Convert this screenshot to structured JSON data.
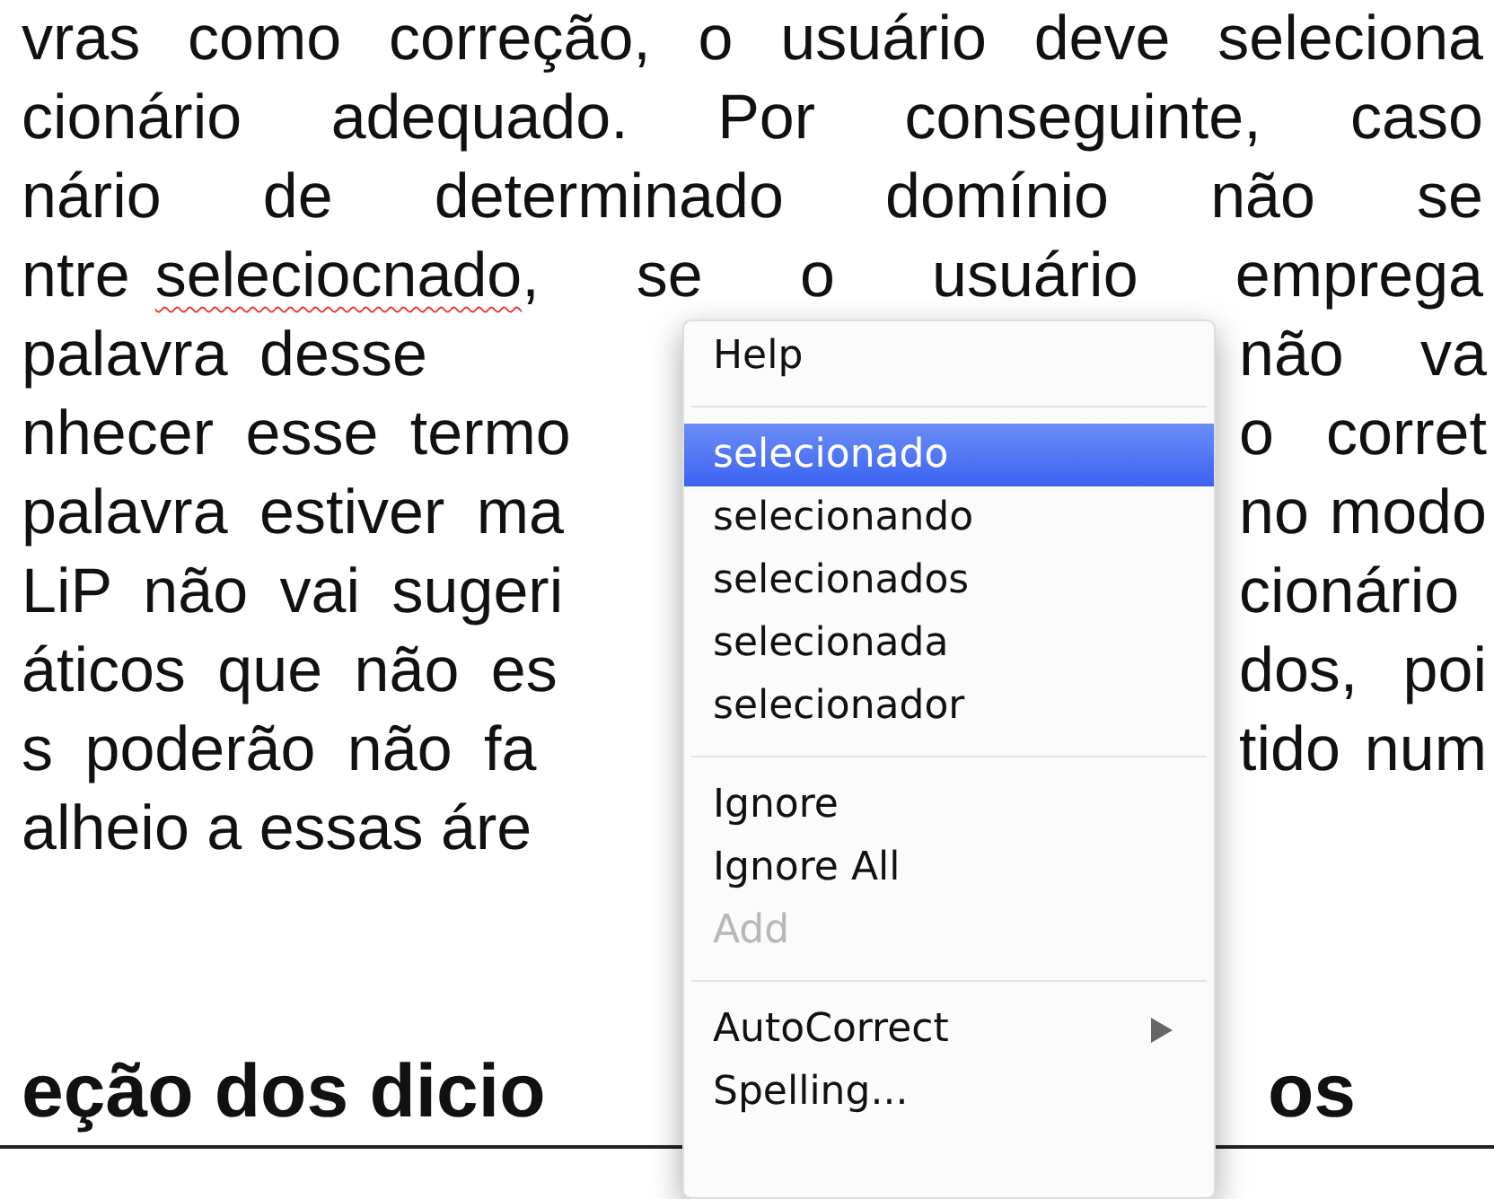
{
  "document": {
    "lines": [
      {
        "left": "vras como correção, o usuário deve seleciona"
      },
      {
        "left": "cionário adequado. Por conseguinte, caso"
      },
      {
        "left": "nário de determinado domínio não se"
      },
      {
        "left": "ntre",
        "misspelled": "seleciocnado",
        "after": ", se o usuário emprega"
      },
      {
        "left": "palavra desse",
        "right": "não va"
      },
      {
        "left": "nhecer esse termo",
        "right": "o corret"
      },
      {
        "left": "palavra estiver ma",
        "right": "no modo"
      },
      {
        "left": "LiP não vai sugeri",
        "right": "cionário"
      },
      {
        "left": "áticos que não es",
        "right": "dos, poi"
      },
      {
        "left": "s poderão não fa",
        "right": "tido num"
      },
      {
        "left": "alheio a essas áre"
      }
    ],
    "heading": {
      "left": "eção dos dicio",
      "right": "os"
    }
  },
  "context_menu": {
    "items": [
      {
        "kind": "item",
        "label": "Help",
        "selected": false,
        "disabled": false
      },
      {
        "kind": "separator"
      },
      {
        "kind": "item",
        "label": "selecionado",
        "selected": true,
        "disabled": false
      },
      {
        "kind": "item",
        "label": "selecionando",
        "selected": false,
        "disabled": false
      },
      {
        "kind": "item",
        "label": "selecionados",
        "selected": false,
        "disabled": false
      },
      {
        "kind": "item",
        "label": "selecionada",
        "selected": false,
        "disabled": false
      },
      {
        "kind": "item",
        "label": "selecionador",
        "selected": false,
        "disabled": false
      },
      {
        "kind": "separator"
      },
      {
        "kind": "item",
        "label": "Ignore",
        "selected": false,
        "disabled": false
      },
      {
        "kind": "item",
        "label": "Ignore All",
        "selected": false,
        "disabled": false
      },
      {
        "kind": "item",
        "label": "Add",
        "selected": false,
        "disabled": true
      },
      {
        "kind": "separator"
      },
      {
        "kind": "item",
        "label": "AutoCorrect",
        "selected": false,
        "disabled": false,
        "submenu": true
      },
      {
        "kind": "item",
        "label": "Spelling...",
        "selected": false,
        "disabled": false
      }
    ]
  }
}
